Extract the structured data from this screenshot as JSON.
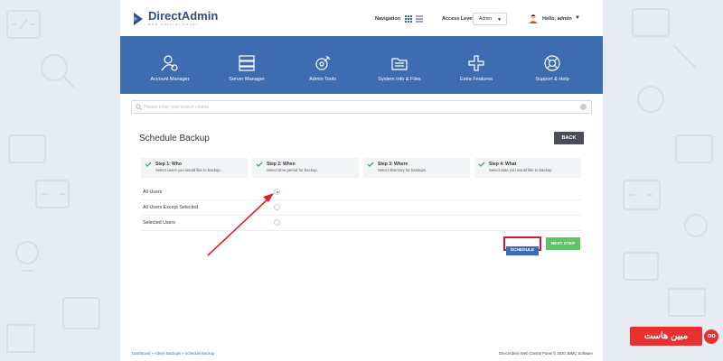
{
  "header": {
    "brand": "DirectAdmin",
    "brand_sub": "web control panel",
    "navigation_label": "Navigation",
    "access_level_label": "Access Level",
    "access_level_value": "Admin",
    "user_greeting": "Hello, admin"
  },
  "nav_band": {
    "items": [
      {
        "label": "Account Manager",
        "icon": "user-gear-icon"
      },
      {
        "label": "Server Manager",
        "icon": "server-icon"
      },
      {
        "label": "Admin Tools",
        "icon": "tools-icon"
      },
      {
        "label": "System Info & Files",
        "icon": "folder-icon"
      },
      {
        "label": "Extra Features",
        "icon": "plus-icon"
      },
      {
        "label": "Support & Help",
        "icon": "lifebuoy-icon"
      }
    ]
  },
  "search": {
    "placeholder": "Please enter your search criteria",
    "value": ""
  },
  "page": {
    "title": "Schedule Backup",
    "back_label": "BACK"
  },
  "steps": [
    {
      "title": "Step 1: Who",
      "desc": "Select users you would like to backup."
    },
    {
      "title": "Step 2: When",
      "desc": "Select time period for backup."
    },
    {
      "title": "Step 3: Where",
      "desc": "Select directory for backups."
    },
    {
      "title": "Step 4: What",
      "desc": "Select data you would like to backup."
    }
  ],
  "options": [
    {
      "label": "All Users",
      "selected": true
    },
    {
      "label": "All Users Except Selected",
      "selected": false
    },
    {
      "label": "Selected Users",
      "selected": false
    }
  ],
  "actions": {
    "schedule_label": "SCHEDULE",
    "next_label": "NEXT STEP"
  },
  "footer": {
    "breadcrumb": [
      "Dashboard",
      "Admin Backups",
      "Schedule Backup"
    ],
    "breadcrumb_sep": " » ",
    "copyright": "DirectAdmin Web Control Panel © 2020 JBMC Software"
  },
  "watermark": {
    "text": "مبین هاست"
  },
  "colors": {
    "brand_blue": "#3e6cb0",
    "next_green": "#5cc36b",
    "highlight_red": "#d6182a",
    "background": "#e6ecf2"
  }
}
